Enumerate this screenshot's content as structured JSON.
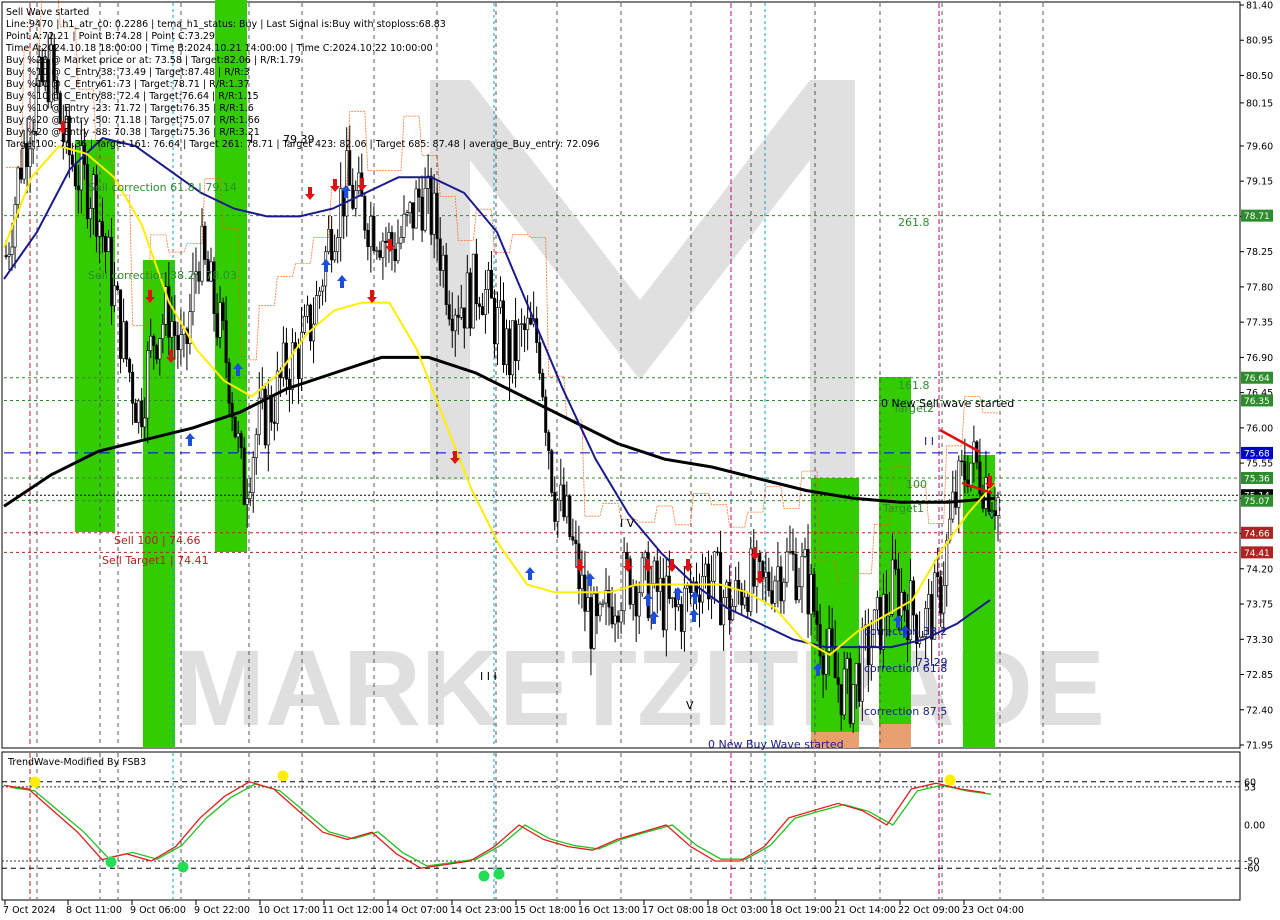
{
  "colors": {
    "background": "#ffffff",
    "green_zone": "#33cc00",
    "orange_zone": "#e8a070",
    "ema_fast": "#ffee00",
    "ema_mid": "#1a1a8c",
    "ema_slow": "#000000",
    "buy_arrow": "#1a4fd8",
    "sell_arrow": "#e01010",
    "target_green": "#2e8b2e",
    "sell_level": "#b22222",
    "blue_level": "#0000cc",
    "stop_line": "#ff5500",
    "osc_red": "#e02020",
    "osc_green": "#20c020",
    "osc_dot_yellow": "#ffee00",
    "osc_dot_green": "#22dd55"
  },
  "watermark": "MARKETZITRADE",
  "info_panel": [
    "Sell Wave started",
    "Line:9470 | h1_atr_c0: 0.2286 | tema_h1_status: Buy | Last Signal is:Buy with stoploss:68.83",
    "Point A:72.21 | Point B:74.28 | Point C:73.29",
    "Time A:2024.10.18 18:00:00 | Time B:2024.10.21 14:00:00 | Time C:2024.10.22 10:00:00",
    "Buy %20 @ Market price or at: 73.58 | Target:82.06 | R/R:1.79",
    "Buy %10 @ C_Entry38: 73.49 | Target:87.48 | R/R:3",
    "Buy %10 @ C_Entry61: 73 | Target:78.71 | R/R:1.37",
    "Buy %10 @ C_Entry88: 72.4 | Target:76.64 | R/R:1.15",
    "Buy %10 @ Entry -23: 71.72 | Target:76.35 | R/R:1.6",
    "Buy %20 @ Entry -50: 71.18 | Target:75.07 | R/R:1.66",
    "Buy %20 @ Entry -88: 70.38 | Target:75.36 | R/R:3.21",
    "Target100: 75.36 | Target 161: 76.64 | Target 261: 78.71 | Target 423: 82.06 | Target 685: 87.48 | average_Buy_entry: 72.096"
  ],
  "annotations": {
    "sell_correction_618": "Sell correction 61.8 | 79.14",
    "sell_correction_382": "Sell correction 38.2 | 78.03",
    "price_7939": "79.39",
    "sell_100": "Sell 100 | 74.66",
    "sell_target1": "Sell Target1 | 74.41",
    "lvl_2618": "261.8",
    "lvl_1618": "161.8",
    "target2": "Target2",
    "new_sell_wave": "0 New Sell wave started",
    "lvl_100": "100",
    "target1": "Target1",
    "correction_382": "correction 38.2",
    "correction_618": "correction 61.8",
    "correction_875": "correction 87.5",
    "price_7329": "73.29",
    "new_buy_wave": "0 New Buy Wave started",
    "wave_iii": "I I I",
    "wave_iv": "I V",
    "wave_v": "V",
    "wave_i": "I",
    "wave_ii": "I I",
    "wave_v2": "V"
  },
  "oscillator": {
    "title": "TrendWave-Modified By FSB3",
    "levels": [
      "60",
      "53",
      "0.00",
      "-50",
      "-60"
    ]
  },
  "chart_data": {
    "type": "candlestick",
    "instrument_title": "Sell Wave started",
    "y_axis_ticks": [
      "81.40",
      "80.95",
      "80.50",
      "80.15",
      "79.60",
      "79.15",
      "78.70",
      "78.25",
      "77.80",
      "77.35",
      "76.90",
      "76.45",
      "76.00",
      "75.55",
      "75.10",
      "74.65",
      "74.20",
      "73.75",
      "73.30",
      "72.85",
      "72.40",
      "71.95"
    ],
    "y_range": [
      71.95,
      81.4
    ],
    "x_axis_ticks": [
      "7 Oct 2024",
      "8 Oct 11:00",
      "9 Oct 06:00",
      "9 Oct 22:00",
      "10 Oct 17:00",
      "11 Oct 12:00",
      "14 Oct 07:00",
      "14 Oct 23:00",
      "15 Oct 18:00",
      "16 Oct 13:00",
      "17 Oct 08:00",
      "18 Oct 03:00",
      "18 Oct 19:00",
      "21 Oct 14:00",
      "22 Oct 09:00",
      "23 Oct 04:00"
    ],
    "price_tags": [
      {
        "label": "78.71",
        "value": 78.71,
        "color": "#2e8b2e"
      },
      {
        "label": "76.64",
        "value": 76.64,
        "color": "#2e8b2e"
      },
      {
        "label": "76.35",
        "value": 76.35,
        "color": "#2e8b2e"
      },
      {
        "label": "75.68",
        "value": 75.68,
        "color": "#0000cc"
      },
      {
        "label": "75.36",
        "value": 75.36,
        "color": "#2e8b2e"
      },
      {
        "label": "75.14",
        "value": 75.14,
        "color": "#000000"
      },
      {
        "label": "75.07",
        "value": 75.07,
        "color": "#2e8b2e"
      },
      {
        "label": "74.66",
        "value": 74.66,
        "color": "#b22222"
      },
      {
        "label": "74.41",
        "value": 74.41,
        "color": "#b22222"
      }
    ],
    "close_path": [
      78.2,
      79.4,
      80.2,
      80.6,
      79.6,
      79.2,
      79.0,
      78.0,
      77.0,
      76.2,
      77.2,
      77.5,
      76.8,
      78.3,
      77.6,
      76.8,
      75.2,
      76.0,
      76.3,
      76.8,
      77.0,
      77.6,
      78.6,
      79.1,
      78.8,
      78.6,
      78.3,
      78.5,
      79.0,
      78.6,
      77.7,
      77.6,
      77.9,
      77.4,
      76.9,
      77.2,
      77.1,
      75.2,
      74.7,
      73.8,
      73.3,
      73.9,
      74.1,
      74.0,
      73.9,
      73.6,
      73.8,
      74.2,
      74.0,
      73.7,
      74.1,
      73.9,
      74.2,
      74.3,
      74.1,
      73.4,
      72.8,
      72.6,
      73.1,
      73.5,
      74.0,
      73.7,
      73.5,
      73.8,
      75.0,
      75.6,
      75.4,
      75.1
    ],
    "ema_fast": [
      78.3,
      79.2,
      79.6,
      79.5,
      79.2,
      78.6,
      77.6,
      77.0,
      76.6,
      76.4,
      76.7,
      77.2,
      77.5,
      77.6,
      77.6,
      77.0,
      76.1,
      75.2,
      74.5,
      74.0,
      73.9,
      73.9,
      73.9,
      74.0,
      74.0,
      74.0,
      74.0,
      73.9,
      73.7,
      73.3,
      73.1,
      73.4,
      73.6,
      73.8,
      74.4,
      74.9,
      75.3
    ],
    "ema_mid": [
      77.9,
      78.5,
      79.3,
      79.7,
      79.6,
      79.3,
      79.0,
      78.8,
      78.7,
      78.7,
      78.8,
      79.0,
      79.2,
      79.2,
      79.0,
      78.5,
      77.5,
      76.5,
      75.6,
      74.9,
      74.4,
      74.0,
      73.7,
      73.5,
      73.3,
      73.2,
      73.2,
      73.2,
      73.3,
      73.5,
      73.8
    ],
    "ema_slow": [
      75.0,
      75.4,
      75.7,
      75.85,
      76.0,
      76.2,
      76.5,
      76.7,
      76.9,
      76.9,
      76.7,
      76.4,
      76.1,
      75.8,
      75.6,
      75.5,
      75.35,
      75.2,
      75.1,
      75.05,
      75.05,
      75.1
    ],
    "oscillator_series": [
      55,
      50,
      20,
      -10,
      -48,
      -40,
      -50,
      -30,
      10,
      40,
      60,
      50,
      20,
      -10,
      -20,
      -10,
      -40,
      -60,
      -55,
      -50,
      -30,
      0,
      -20,
      -30,
      -35,
      -20,
      -10,
      0,
      -30,
      -50,
      -50,
      -30,
      10,
      20,
      30,
      20,
      0,
      50,
      58,
      50,
      45
    ]
  }
}
